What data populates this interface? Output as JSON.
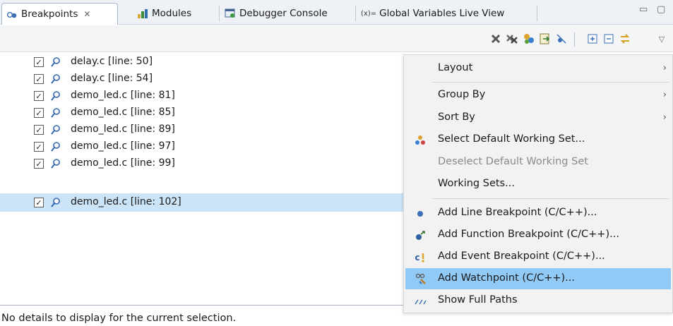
{
  "tabs": [
    {
      "label": "Breakpoints",
      "close": "✕",
      "active": true
    },
    {
      "label": "Modules"
    },
    {
      "label": "Debugger Console"
    },
    {
      "label": "Global Variables Live View",
      "prefix": "(x)="
    }
  ],
  "window_controls": {
    "minimize": "▭",
    "maximize": "▢"
  },
  "toolbar_icons": [
    "remove-icon",
    "remove-all-icon",
    "linked-icon",
    "goto-file-icon",
    "skip-all-icon",
    "expand-all-icon",
    "collapse-all-icon",
    "link-with-view-icon",
    "view-menu-icon"
  ],
  "breakpoints": [
    {
      "label": "delay.c [line: 50]",
      "checked": true
    },
    {
      "label": "delay.c [line: 54]",
      "checked": true
    },
    {
      "label": "demo_led.c [line: 81]",
      "checked": true
    },
    {
      "label": "demo_led.c [line: 85]",
      "checked": true
    },
    {
      "label": "demo_led.c [line: 89]",
      "checked": true
    },
    {
      "label": "demo_led.c [line: 97]",
      "checked": true
    },
    {
      "label": "demo_led.c [line: 99]",
      "checked": true
    },
    {
      "label": "demo_led.c [line: 102]",
      "checked": true,
      "selected": true
    }
  ],
  "checkbox_mark": "✓",
  "menu": {
    "items": [
      {
        "label": "Layout",
        "submenu": true
      },
      {
        "label": "Group By",
        "submenu": true
      },
      {
        "label": "Sort By",
        "submenu": true
      },
      {
        "label": "Select Default Working Set...",
        "icon": "working-set-icon"
      },
      {
        "label": "Deselect Default Working Set",
        "disabled": true
      },
      {
        "label": "Working Sets..."
      },
      {
        "label": "Add Line Breakpoint (C/C++)...",
        "icon": "line-breakpoint-icon"
      },
      {
        "label": "Add Function Breakpoint (C/C++)...",
        "icon": "function-breakpoint-icon"
      },
      {
        "label": "Add Event Breakpoint (C/C++)...",
        "icon": "event-breakpoint-icon"
      },
      {
        "label": "Add Watchpoint (C/C++)...",
        "icon": "watchpoint-icon",
        "highlighted": true
      },
      {
        "label": "Show Full Paths",
        "icon": "full-paths-icon"
      }
    ],
    "submenu_arrow": "›",
    "icon_glyphs": {
      "event_prefix": "c"
    }
  },
  "details": {
    "text": "No details to display for the current selection."
  },
  "colors": {
    "selected_row": "#cce4f7",
    "menu_highlight": "#91c9f7",
    "menu_bg": "#f2f2f2"
  }
}
